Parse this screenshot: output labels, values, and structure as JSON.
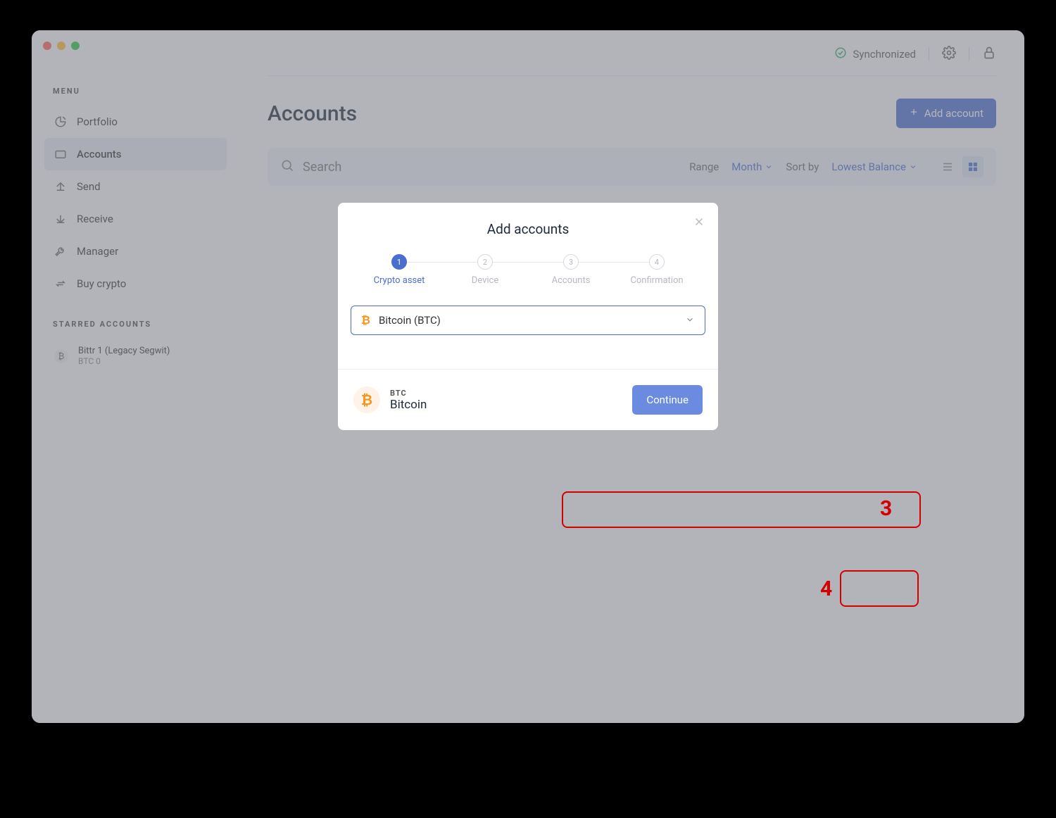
{
  "sidebar": {
    "menu_heading": "MENU",
    "items": [
      {
        "label": "Portfolio"
      },
      {
        "label": "Accounts"
      },
      {
        "label": "Send"
      },
      {
        "label": "Receive"
      },
      {
        "label": "Manager"
      },
      {
        "label": "Buy crypto"
      }
    ],
    "starred_heading": "STARRED ACCOUNTS",
    "starred": [
      {
        "icon": "₿",
        "name": "Bittr 1 (Legacy Segwit)",
        "balance": "BTC 0"
      }
    ]
  },
  "topbar": {
    "sync_status": "Synchronized"
  },
  "page": {
    "title": "Accounts",
    "add_account_btn": "Add account"
  },
  "toolbar": {
    "search_placeholder": "Search",
    "range_label": "Range",
    "range_value": "Month",
    "sort_label": "Sort by",
    "sort_value": "Lowest Balance"
  },
  "modal": {
    "title": "Add accounts",
    "steps": [
      {
        "num": "1",
        "label": "Crypto asset"
      },
      {
        "num": "2",
        "label": "Device"
      },
      {
        "num": "3",
        "label": "Accounts"
      },
      {
        "num": "4",
        "label": "Confirmation"
      }
    ],
    "selected_asset": "Bitcoin (BTC)",
    "footer_ticker": "BTC",
    "footer_name": "Bitcoin",
    "continue_btn": "Continue"
  },
  "annotations": {
    "label3": "3",
    "label4": "4"
  }
}
